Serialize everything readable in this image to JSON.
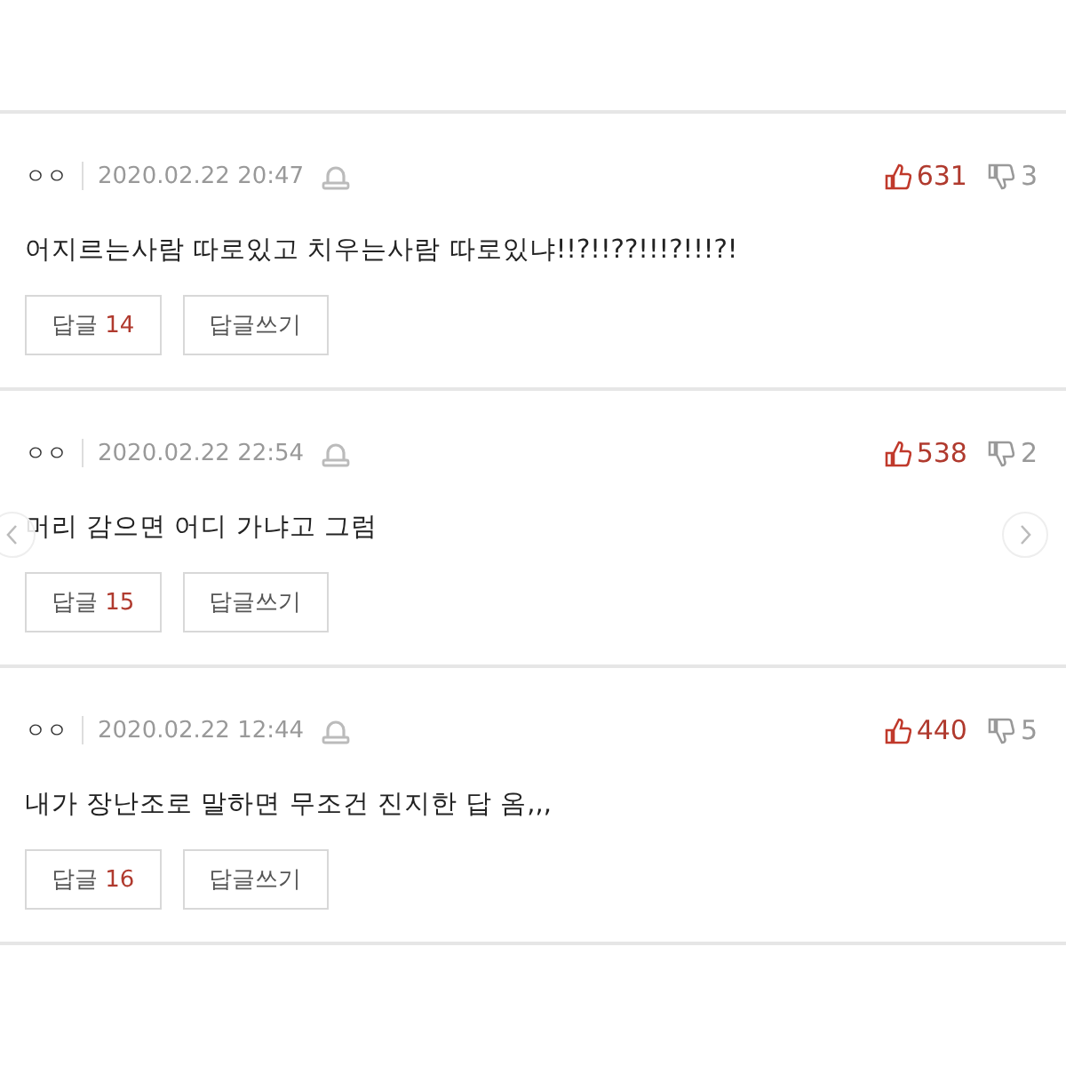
{
  "comments": [
    {
      "author": "ㅇㅇ",
      "date": "2020.02.22 20:47",
      "likes": "631",
      "dislikes": "3",
      "text": "어지르는사람 따로있고 치우는사람 따로있냐!!?!!??!!!?!!!?!",
      "reply_label": "답글",
      "reply_count": "14",
      "write_label": "답글쓰기",
      "nav_arrows": false
    },
    {
      "author": "ㅇㅇ",
      "date": "2020.02.22 22:54",
      "likes": "538",
      "dislikes": "2",
      "text": "머리 감으면 어디 가냐고 그럼",
      "reply_label": "답글",
      "reply_count": "15",
      "write_label": "답글쓰기",
      "nav_arrows": true
    },
    {
      "author": "ㅇㅇ",
      "date": "2020.02.22 12:44",
      "likes": "440",
      "dislikes": "5",
      "text": "내가 장난조로 말하면 무조건 진지한 답 옴,,,",
      "reply_label": "답글",
      "reply_count": "16",
      "write_label": "답글쓰기",
      "nav_arrows": false
    }
  ]
}
